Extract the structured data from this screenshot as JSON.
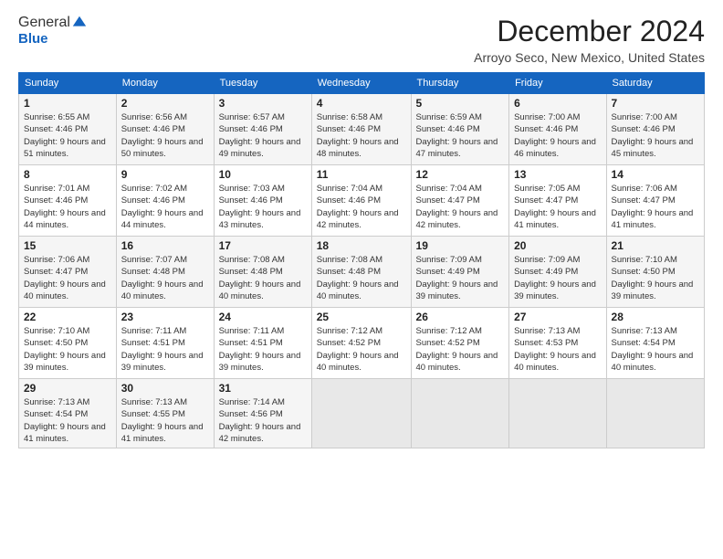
{
  "logo": {
    "general": "General",
    "blue": "Blue"
  },
  "title": "December 2024",
  "location": "Arroyo Seco, New Mexico, United States",
  "days_of_week": [
    "Sunday",
    "Monday",
    "Tuesday",
    "Wednesday",
    "Thursday",
    "Friday",
    "Saturday"
  ],
  "weeks": [
    [
      {
        "day": 1,
        "sunrise": "6:55 AM",
        "sunset": "4:46 PM",
        "daylight": "9 hours and 51 minutes."
      },
      {
        "day": 2,
        "sunrise": "6:56 AM",
        "sunset": "4:46 PM",
        "daylight": "9 hours and 50 minutes."
      },
      {
        "day": 3,
        "sunrise": "6:57 AM",
        "sunset": "4:46 PM",
        "daylight": "9 hours and 49 minutes."
      },
      {
        "day": 4,
        "sunrise": "6:58 AM",
        "sunset": "4:46 PM",
        "daylight": "9 hours and 48 minutes."
      },
      {
        "day": 5,
        "sunrise": "6:59 AM",
        "sunset": "4:46 PM",
        "daylight": "9 hours and 47 minutes."
      },
      {
        "day": 6,
        "sunrise": "7:00 AM",
        "sunset": "4:46 PM",
        "daylight": "9 hours and 46 minutes."
      },
      {
        "day": 7,
        "sunrise": "7:00 AM",
        "sunset": "4:46 PM",
        "daylight": "9 hours and 45 minutes."
      }
    ],
    [
      {
        "day": 8,
        "sunrise": "7:01 AM",
        "sunset": "4:46 PM",
        "daylight": "9 hours and 44 minutes."
      },
      {
        "day": 9,
        "sunrise": "7:02 AM",
        "sunset": "4:46 PM",
        "daylight": "9 hours and 44 minutes."
      },
      {
        "day": 10,
        "sunrise": "7:03 AM",
        "sunset": "4:46 PM",
        "daylight": "9 hours and 43 minutes."
      },
      {
        "day": 11,
        "sunrise": "7:04 AM",
        "sunset": "4:46 PM",
        "daylight": "9 hours and 42 minutes."
      },
      {
        "day": 12,
        "sunrise": "7:04 AM",
        "sunset": "4:47 PM",
        "daylight": "9 hours and 42 minutes."
      },
      {
        "day": 13,
        "sunrise": "7:05 AM",
        "sunset": "4:47 PM",
        "daylight": "9 hours and 41 minutes."
      },
      {
        "day": 14,
        "sunrise": "7:06 AM",
        "sunset": "4:47 PM",
        "daylight": "9 hours and 41 minutes."
      }
    ],
    [
      {
        "day": 15,
        "sunrise": "7:06 AM",
        "sunset": "4:47 PM",
        "daylight": "9 hours and 40 minutes."
      },
      {
        "day": 16,
        "sunrise": "7:07 AM",
        "sunset": "4:48 PM",
        "daylight": "9 hours and 40 minutes."
      },
      {
        "day": 17,
        "sunrise": "7:08 AM",
        "sunset": "4:48 PM",
        "daylight": "9 hours and 40 minutes."
      },
      {
        "day": 18,
        "sunrise": "7:08 AM",
        "sunset": "4:48 PM",
        "daylight": "9 hours and 40 minutes."
      },
      {
        "day": 19,
        "sunrise": "7:09 AM",
        "sunset": "4:49 PM",
        "daylight": "9 hours and 39 minutes."
      },
      {
        "day": 20,
        "sunrise": "7:09 AM",
        "sunset": "4:49 PM",
        "daylight": "9 hours and 39 minutes."
      },
      {
        "day": 21,
        "sunrise": "7:10 AM",
        "sunset": "4:50 PM",
        "daylight": "9 hours and 39 minutes."
      }
    ],
    [
      {
        "day": 22,
        "sunrise": "7:10 AM",
        "sunset": "4:50 PM",
        "daylight": "9 hours and 39 minutes."
      },
      {
        "day": 23,
        "sunrise": "7:11 AM",
        "sunset": "4:51 PM",
        "daylight": "9 hours and 39 minutes."
      },
      {
        "day": 24,
        "sunrise": "7:11 AM",
        "sunset": "4:51 PM",
        "daylight": "9 hours and 39 minutes."
      },
      {
        "day": 25,
        "sunrise": "7:12 AM",
        "sunset": "4:52 PM",
        "daylight": "9 hours and 40 minutes."
      },
      {
        "day": 26,
        "sunrise": "7:12 AM",
        "sunset": "4:52 PM",
        "daylight": "9 hours and 40 minutes."
      },
      {
        "day": 27,
        "sunrise": "7:13 AM",
        "sunset": "4:53 PM",
        "daylight": "9 hours and 40 minutes."
      },
      {
        "day": 28,
        "sunrise": "7:13 AM",
        "sunset": "4:54 PM",
        "daylight": "9 hours and 40 minutes."
      }
    ],
    [
      {
        "day": 29,
        "sunrise": "7:13 AM",
        "sunset": "4:54 PM",
        "daylight": "9 hours and 41 minutes."
      },
      {
        "day": 30,
        "sunrise": "7:13 AM",
        "sunset": "4:55 PM",
        "daylight": "9 hours and 41 minutes."
      },
      {
        "day": 31,
        "sunrise": "7:14 AM",
        "sunset": "4:56 PM",
        "daylight": "9 hours and 42 minutes."
      },
      null,
      null,
      null,
      null
    ]
  ]
}
